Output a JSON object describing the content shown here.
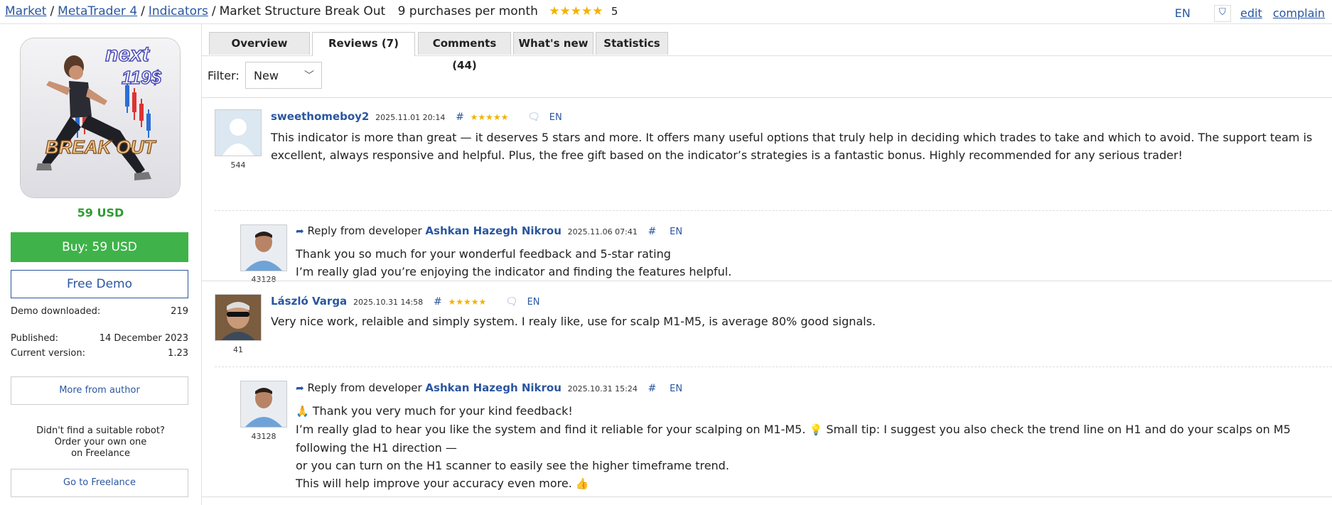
{
  "breadcrumb": {
    "market": "Market",
    "platform": "MetaTrader 4",
    "category": "Indicators",
    "product": "Market Structure Break Out",
    "purchases": "9 purchases per month",
    "stars": "★★★★★",
    "rating": "5"
  },
  "topright": {
    "lang": "EN",
    "edit": "edit",
    "complain": "complain"
  },
  "product": {
    "image_text_next": "next",
    "image_text_price": "119$",
    "image_text_title": "BREAK OUT",
    "price": "59 USD",
    "buy_label": "Buy: 59 USD",
    "demo_label": "Free Demo",
    "demo_downloaded_label": "Demo downloaded:",
    "demo_downloaded_value": "219",
    "published_label": "Published:",
    "published_value": "14 December 2023",
    "version_label": "Current version:",
    "version_value": "1.23",
    "more_from_author": "More from author",
    "freelance_line1": "Didn't find a suitable robot?",
    "freelance_line2": "Order your own one",
    "freelance_line3": "on Freelance",
    "go_freelance": "Go to Freelance"
  },
  "tabs": [
    "Overview",
    "Reviews (7)",
    "Comments (44)",
    "What's new",
    "Statistics"
  ],
  "active_tab": "Reviews (7)",
  "filter": {
    "label": "Filter:",
    "value": "New"
  },
  "reviews": [
    {
      "author": "sweethomeboy2",
      "date": "2025.11.01 20:14",
      "hash": "#",
      "stars": "★★★★★",
      "lang": "EN",
      "avatar_count": "544",
      "text": "This indicator is more than great — it deserves 5 stars and more. It offers many useful options that truly help in deciding which trades to take and which to avoid. The support team is excellent, always responsive and helpful. Plus, the free gift based on the indicator’s strategies is a fantastic bonus. Highly recommended for any serious trader!",
      "reply": {
        "prefix": "Reply from developer",
        "author": "Ashkan Hazegh Nikrou",
        "date": "2025.11.06 07:41",
        "hash": "#",
        "lang": "EN",
        "avatar_count": "43128",
        "lines": [
          "Thank you so much for your wonderful feedback and 5-star rating",
          "I’m really glad you’re enjoying the indicator and finding the features helpful."
        ]
      }
    },
    {
      "author": "László Varga",
      "date": "2025.10.31 14:58",
      "hash": "#",
      "stars": "★★★★★",
      "lang": "EN",
      "avatar_count": "41",
      "text": "Very nice work, relaible and simply system. I realy like, use for scalp M1-M5, is average 80% good signals.",
      "reply": {
        "prefix": "Reply from developer",
        "author": "Ashkan Hazegh Nikrou",
        "date": "2025.10.31 15:24",
        "hash": "#",
        "lang": "EN",
        "avatar_count": "43128",
        "lines": [
          "Thank you very much for your kind feedback!",
          "I’m really glad to hear you like the system and find it reliable for your scalping on M1-M5.",
          "Small tip: I suggest you also check the trend line on H1 and do your scalps on M5 following the H1 direction —",
          "or you can turn on the H1 scanner to easily see the higher timeframe trend.",
          "This will help improve your accuracy even more."
        ]
      }
    }
  ],
  "icons": {
    "reply": "reply-arrow-icon",
    "comment": "speech-bubble-icon",
    "pray": "folded-hands-emoji",
    "bulb": "light-bulb-emoji",
    "thumbs": "thumbs-up-emoji"
  }
}
